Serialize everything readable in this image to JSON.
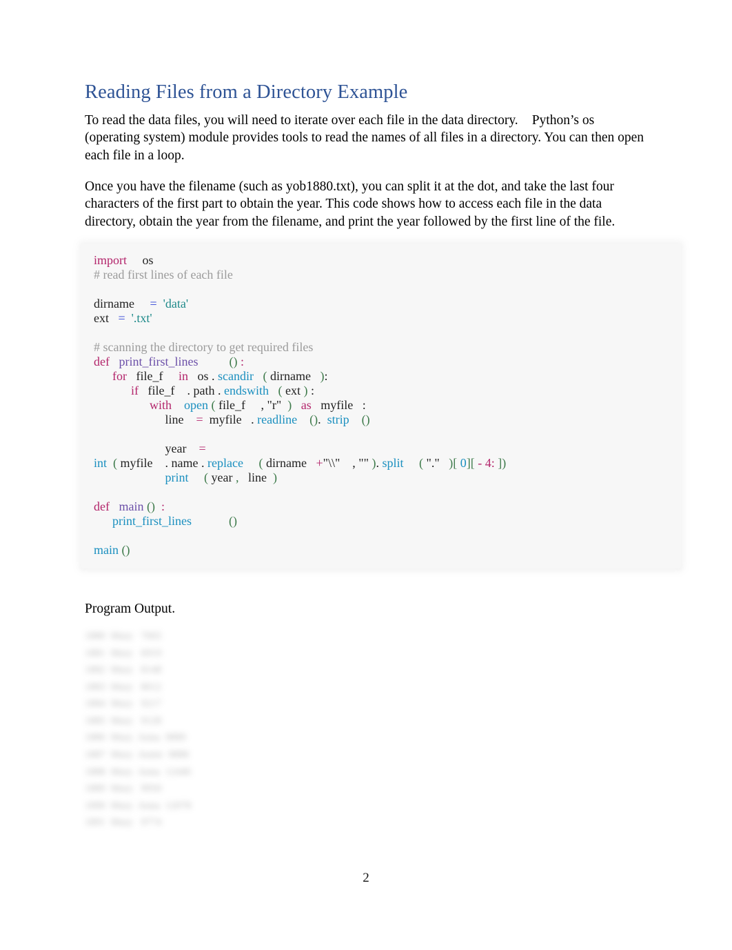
{
  "document": {
    "title": "Reading Files from a Directory Example",
    "paragraphs": [
      {
        "id": "intro",
        "part_a": "To read the data files, you will need to iterate over each file in the data directory.",
        "part_b": "Python’s os (operating system) module provides tools to read the names of all files in a directory. You can then open each file in a loop."
      },
      {
        "id": "explanation",
        "text": "Once you have the filename (such as yob1880.txt), you can split it at the dot, and take the last four characters of the first part to obtain the year. This code shows how to access each file in the data directory, obtain the year from the filename, and print the year followed by the first line of the file."
      }
    ],
    "code_block": {
      "language": "python",
      "lines": [
        {
          "id": "l1",
          "tokens": [
            {
              "t": "import",
              "c": "kw"
            },
            {
              "t": "     os",
              "c": "plain"
            }
          ]
        },
        {
          "id": "l2",
          "tokens": [
            {
              "t": "# read first lines of each file",
              "c": "cmt"
            }
          ]
        },
        {
          "id": "l3",
          "tokens": [
            {
              "t": "",
              "c": "plain"
            }
          ]
        },
        {
          "id": "l4",
          "tokens": [
            {
              "t": "dirname     ",
              "c": "plain"
            },
            {
              "t": "=",
              "c": "op"
            },
            {
              "t": "  ",
              "c": "plain"
            },
            {
              "t": "'data'",
              "c": "str"
            }
          ]
        },
        {
          "id": "l5",
          "tokens": [
            {
              "t": "ext   ",
              "c": "plain"
            },
            {
              "t": "=",
              "c": "op"
            },
            {
              "t": "  ",
              "c": "plain"
            },
            {
              "t": "'.txt'",
              "c": "str"
            }
          ]
        },
        {
          "id": "l6",
          "tokens": [
            {
              "t": "",
              "c": "plain"
            }
          ]
        },
        {
          "id": "l7",
          "tokens": [
            {
              "t": "# scanning the directory to get required files",
              "c": "cmt"
            }
          ]
        },
        {
          "id": "l8",
          "tokens": [
            {
              "t": "def",
              "c": "kw"
            },
            {
              "t": "   ",
              "c": "plain"
            },
            {
              "t": "print_first_lines",
              "c": "fndef"
            },
            {
              "t": "          ",
              "c": "plain"
            },
            {
              "t": "()",
              "c": "paren"
            },
            {
              "t": " ",
              "c": "plain"
            },
            {
              "t": ":",
              "c": "opm"
            }
          ]
        },
        {
          "id": "l9",
          "tokens": [
            {
              "t": "      ",
              "c": "plain"
            },
            {
              "t": "for",
              "c": "kw"
            },
            {
              "t": "   file_f     ",
              "c": "plain"
            },
            {
              "t": "in",
              "c": "kw"
            },
            {
              "t": "   os ",
              "c": "plain"
            },
            {
              "t": ".",
              "c": "plain"
            },
            {
              "t": " ",
              "c": "plain"
            },
            {
              "t": "scandir",
              "c": "fn"
            },
            {
              "t": "   ",
              "c": "plain"
            },
            {
              "t": "(",
              "c": "paren"
            },
            {
              "t": " dirname   ",
              "c": "plain"
            },
            {
              "t": ")",
              "c": "paren"
            },
            {
              "t": ":",
              "c": "plain"
            }
          ]
        },
        {
          "id": "l10",
          "tokens": [
            {
              "t": "            ",
              "c": "plain"
            },
            {
              "t": "if",
              "c": "kw"
            },
            {
              "t": "   file_f    ",
              "c": "plain"
            },
            {
              "t": ".",
              "c": "plain"
            },
            {
              "t": " path ",
              "c": "plain"
            },
            {
              "t": ".",
              "c": "plain"
            },
            {
              "t": " ",
              "c": "plain"
            },
            {
              "t": "endswith",
              "c": "fn"
            },
            {
              "t": "   ",
              "c": "plain"
            },
            {
              "t": "(",
              "c": "paren"
            },
            {
              "t": " ext ",
              "c": "plain"
            },
            {
              "t": ")",
              "c": "paren"
            },
            {
              "t": " :",
              "c": "plain"
            }
          ]
        },
        {
          "id": "l11",
          "tokens": [
            {
              "t": "                  ",
              "c": "plain"
            },
            {
              "t": "with",
              "c": "kw"
            },
            {
              "t": "    ",
              "c": "plain"
            },
            {
              "t": "open",
              "c": "fn"
            },
            {
              "t": " ",
              "c": "plain"
            },
            {
              "t": "(",
              "c": "paren"
            },
            {
              "t": " file_f     ",
              "c": "plain"
            },
            {
              "t": ",",
              "c": "plain"
            },
            {
              "t": " \"r\"",
              "c": "plain"
            },
            {
              "t": "  ",
              "c": "plain"
            },
            {
              "t": ")",
              "c": "paren"
            },
            {
              "t": "   ",
              "c": "plain"
            },
            {
              "t": "as",
              "c": "kw"
            },
            {
              "t": "   myfile   ",
              "c": "plain"
            },
            {
              "t": ":",
              "c": "plain"
            }
          ]
        },
        {
          "id": "l12",
          "tokens": [
            {
              "t": "                       line    ",
              "c": "plain"
            },
            {
              "t": "=",
              "c": "opm"
            },
            {
              "t": "  myfile   ",
              "c": "plain"
            },
            {
              "t": ".",
              "c": "plain"
            },
            {
              "t": " ",
              "c": "plain"
            },
            {
              "t": "readline",
              "c": "fn"
            },
            {
              "t": "    ",
              "c": "plain"
            },
            {
              "t": "()",
              "c": "paren"
            },
            {
              "t": ". ",
              "c": "plain"
            },
            {
              "t": " ",
              "c": "plain"
            },
            {
              "t": "strip",
              "c": "fn"
            },
            {
              "t": "    ",
              "c": "plain"
            },
            {
              "t": "()",
              "c": "paren"
            }
          ]
        },
        {
          "id": "l13",
          "tokens": [
            {
              "t": "",
              "c": "plain"
            }
          ]
        },
        {
          "id": "l14",
          "tokens": [
            {
              "t": "                       year    ",
              "c": "plain"
            },
            {
              "t": "=",
              "c": "opm"
            }
          ]
        },
        {
          "id": "l15",
          "tokens": [
            {
              "t": "int",
              "c": "fn"
            },
            {
              "t": "  ",
              "c": "plain"
            },
            {
              "t": "(",
              "c": "paren"
            },
            {
              "t": " myfile    ",
              "c": "plain"
            },
            {
              "t": ".",
              "c": "plain"
            },
            {
              "t": " name ",
              "c": "plain"
            },
            {
              "t": ".",
              "c": "plain"
            },
            {
              "t": " ",
              "c": "plain"
            },
            {
              "t": "replace",
              "c": "fn"
            },
            {
              "t": "     ",
              "c": "plain"
            },
            {
              "t": "(",
              "c": "paren"
            },
            {
              "t": " dirname   ",
              "c": "plain"
            },
            {
              "t": "+",
              "c": "opm"
            },
            {
              "t": "\"\\\\\"",
              "c": "plain"
            },
            {
              "t": "    ",
              "c": "plain"
            },
            {
              "t": ",",
              "c": "plain"
            },
            {
              "t": " \"\" ",
              "c": "plain"
            },
            {
              "t": ")",
              "c": "paren"
            },
            {
              "t": ". ",
              "c": "plain"
            },
            {
              "t": "split",
              "c": "fn"
            },
            {
              "t": "     ",
              "c": "plain"
            },
            {
              "t": "(",
              "c": "paren"
            },
            {
              "t": " \".\"",
              "c": "plain"
            },
            {
              "t": "   ",
              "c": "plain"
            },
            {
              "t": ")[",
              "c": "paren"
            },
            {
              "t": " ",
              "c": "plain"
            },
            {
              "t": "0",
              "c": "fn"
            },
            {
              "t": "][",
              "c": "paren"
            },
            {
              "t": " ",
              "c": "plain"
            },
            {
              "t": "-",
              "c": "num"
            },
            {
              "t": " ",
              "c": "plain"
            },
            {
              "t": "4",
              "c": "num"
            },
            {
              "t": ":",
              "c": "num"
            },
            {
              "t": " ",
              "c": "plain"
            },
            {
              "t": "])",
              "c": "paren"
            }
          ]
        },
        {
          "id": "l16",
          "tokens": [
            {
              "t": "                       ",
              "c": "plain"
            },
            {
              "t": "print",
              "c": "fn"
            },
            {
              "t": "     ",
              "c": "plain"
            },
            {
              "t": "(",
              "c": "paren"
            },
            {
              "t": " year ",
              "c": "plain"
            },
            {
              "t": ",",
              "c": "paren"
            },
            {
              "t": "   line  ",
              "c": "plain"
            },
            {
              "t": ")",
              "c": "paren"
            }
          ]
        },
        {
          "id": "l17",
          "tokens": [
            {
              "t": "",
              "c": "plain"
            }
          ]
        },
        {
          "id": "l18",
          "tokens": [
            {
              "t": "def",
              "c": "kw"
            },
            {
              "t": "   ",
              "c": "plain"
            },
            {
              "t": "main",
              "c": "fndef"
            },
            {
              "t": " ",
              "c": "plain"
            },
            {
              "t": "()",
              "c": "paren"
            },
            {
              "t": "  ",
              "c": "plain"
            },
            {
              "t": ":",
              "c": "opm"
            }
          ]
        },
        {
          "id": "l19",
          "tokens": [
            {
              "t": "      ",
              "c": "plain"
            },
            {
              "t": "print_first_lines",
              "c": "fn"
            },
            {
              "t": "            ",
              "c": "plain"
            },
            {
              "t": "()",
              "c": "paren"
            }
          ]
        },
        {
          "id": "l20",
          "tokens": [
            {
              "t": "",
              "c": "plain"
            }
          ]
        },
        {
          "id": "l21",
          "tokens": [
            {
              "t": "main",
              "c": "fn"
            },
            {
              "t": " ",
              "c": "plain"
            },
            {
              "t": "()",
              "c": "paren"
            }
          ]
        }
      ]
    },
    "output_label": "Program Output.",
    "program_output_lines": [
      "1880  Mary   7065",
      "1881  Mary   6919",
      "1882  Mary   8148",
      "1883  Mary   8012",
      "1884  Mary   9217",
      "1885  Mary   9128",
      "1886  Mary  Anna  9889",
      "1887  Mary  Annie  9888",
      "1888  Mary  Anna  12446",
      "1889  Mary   9950",
      "1890  Mary  Anna  12078",
      "1891  Mary   9774"
    ],
    "page_number": "2"
  }
}
